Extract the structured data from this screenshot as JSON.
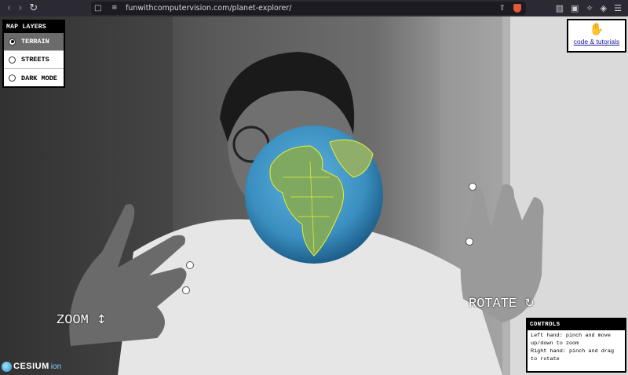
{
  "browser": {
    "back_icon": "chevron-left-icon",
    "forward_icon": "chevron-right-icon",
    "reload_icon": "reload-icon",
    "url": "funwithcomputervision.com/planet-explorer/"
  },
  "layers": {
    "title": "MAP LAYERS",
    "options": [
      {
        "label": "TERRAIN",
        "selected": true
      },
      {
        "label": "STREETS",
        "selected": false
      },
      {
        "label": "DARK MODE",
        "selected": false
      }
    ]
  },
  "tutorials": {
    "link": "code & tutorials",
    "icon": "hand-icon"
  },
  "gestures": {
    "zoom": "ZOOM",
    "zoom_icon": "↕",
    "rotate": "ROTATE",
    "rotate_icon": "↻"
  },
  "controls": {
    "title": "CONTROLS",
    "line1": "Left hand: pinch and move up/down to zoom",
    "line2": "Right hand: pinch and drag to rotate"
  },
  "attribution": {
    "brand": "CESIUM",
    "suffix": "ion"
  },
  "colors": {
    "globe_ocean": "#3a8fc0",
    "globe_land": "#7fa860",
    "border_lines": "#e8f030"
  }
}
